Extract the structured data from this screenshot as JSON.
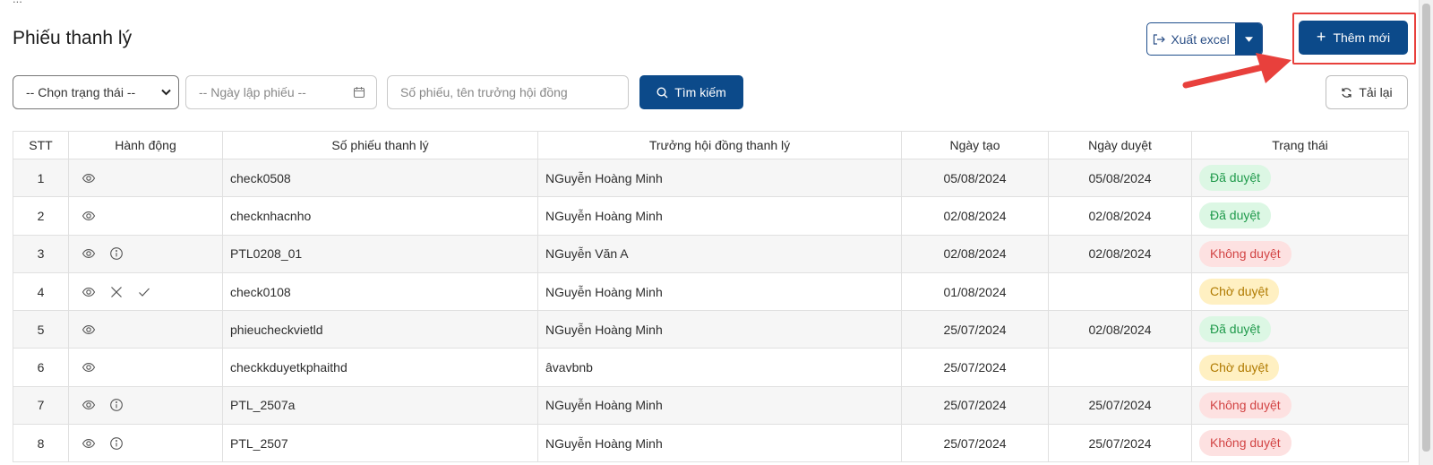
{
  "page": {
    "title": "Phiếu thanh lý",
    "breadcrumb_fragment": "..."
  },
  "toolbar": {
    "export_label": "Xuất excel",
    "export_icon": "export-icon",
    "add_label": "Thêm mới",
    "reload_label": "Tải lại"
  },
  "filters": {
    "status_placeholder": "-- Chọn trạng thái --",
    "date_placeholder": "-- Ngày lập phiếu --",
    "search_placeholder": "Số phiếu, tên trưởng hội đồng",
    "search_button": "Tìm kiếm"
  },
  "table": {
    "headers": [
      "STT",
      "Hành động",
      "Số phiếu thanh lý",
      "Trưởng hội đồng thanh lý",
      "Ngày tạo",
      "Ngày duyệt",
      "Trạng thái"
    ],
    "rows": [
      {
        "stt": "1",
        "actions": [
          "view"
        ],
        "code": "check0508",
        "leader": "NGuyễn Hoàng Minh",
        "created": "05/08/2024",
        "approved": "05/08/2024",
        "status": "Đã duyệt",
        "status_type": "approved"
      },
      {
        "stt": "2",
        "actions": [
          "view"
        ],
        "code": "checknhacnho",
        "leader": "NGuyễn Hoàng Minh",
        "created": "02/08/2024",
        "approved": "02/08/2024",
        "status": "Đã duyệt",
        "status_type": "approved"
      },
      {
        "stt": "3",
        "actions": [
          "view",
          "info"
        ],
        "code": "PTL0208_01",
        "leader": "NGuyễn Văn A",
        "created": "02/08/2024",
        "approved": "02/08/2024",
        "status": "Không duyệt",
        "status_type": "rejected"
      },
      {
        "stt": "4",
        "actions": [
          "view",
          "reject",
          "approve"
        ],
        "code": "check0108",
        "leader": "NGuyễn Hoàng Minh",
        "created": "01/08/2024",
        "approved": "",
        "status": "Chờ duyệt",
        "status_type": "pending"
      },
      {
        "stt": "5",
        "actions": [
          "view"
        ],
        "code": "phieucheckvietld",
        "leader": "NGuyễn Hoàng Minh",
        "created": "25/07/2024",
        "approved": "02/08/2024",
        "status": "Đã duyệt",
        "status_type": "approved"
      },
      {
        "stt": "6",
        "actions": [
          "view"
        ],
        "code": "checkkduyetkphaithd",
        "leader": "âvavbnb",
        "created": "25/07/2024",
        "approved": "",
        "status": "Chờ duyệt",
        "status_type": "pending"
      },
      {
        "stt": "7",
        "actions": [
          "view",
          "info"
        ],
        "code": "PTL_2507a",
        "leader": "NGuyễn Hoàng Minh",
        "created": "25/07/2024",
        "approved": "25/07/2024",
        "status": "Không duyệt",
        "status_type": "rejected"
      },
      {
        "stt": "8",
        "actions": [
          "view",
          "info"
        ],
        "code": "PTL_2507",
        "leader": "NGuyễn Hoàng Minh",
        "created": "25/07/2024",
        "approved": "25/07/2024",
        "status": "Không duyệt",
        "status_type": "rejected"
      }
    ]
  },
  "colors": {
    "primary": "#0c4a8a",
    "highlight": "#e8403c",
    "approved_bg": "#dcf7e4",
    "approved_text": "#1f9a4b",
    "rejected_bg": "#fde1e1",
    "rejected_text": "#d24444",
    "pending_bg": "#fff0c2",
    "pending_text": "#b07a00"
  }
}
